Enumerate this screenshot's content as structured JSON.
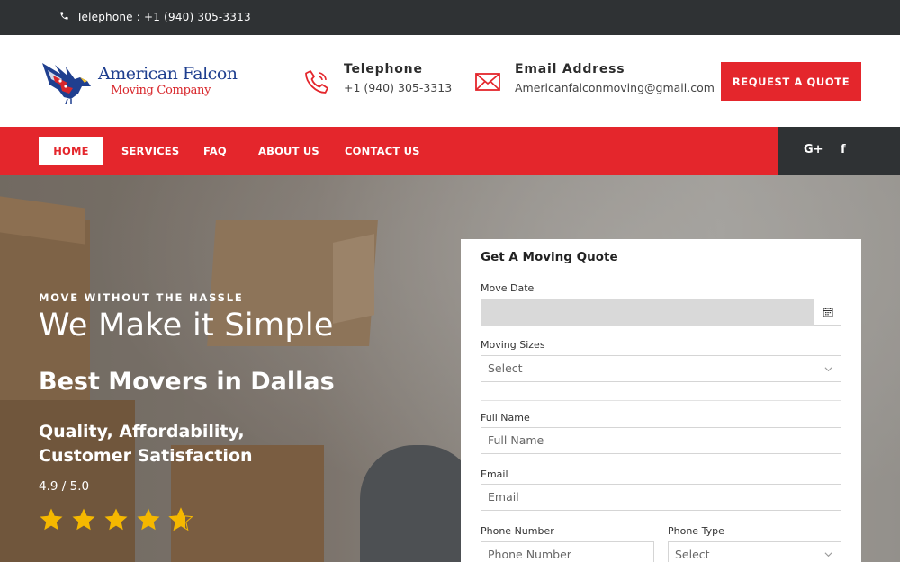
{
  "topbar": {
    "telephone": "Telephone : +1 (940) 305-3313"
  },
  "logo": {
    "line1": "American Falcon",
    "line2": "Moving Company"
  },
  "header": {
    "telephone_title": "Telephone",
    "telephone_value": "+1 (940) 305-3313",
    "email_title": "Email Address",
    "email_value": "Americanfalconmoving@gmail.com",
    "quote_button": "REQUEST A QUOTE"
  },
  "nav": {
    "items": [
      "HOME",
      "SERVICES",
      "FAQ",
      "ABOUT US",
      "CONTACT US"
    ],
    "social": [
      "G+",
      "f"
    ]
  },
  "hero": {
    "eyebrow": "MOVE WITHOUT THE HASSLE",
    "headline": "We Make it Simple",
    "subheadline": "Best Movers in Dallas",
    "tagline": "Quality, Affordability, Customer Satisfaction",
    "rating_text": "4.9 / 5.0",
    "rating_value": 4.9,
    "rating_max": 5
  },
  "form": {
    "title": "Get A Moving Quote",
    "move_date_label": "Move Date",
    "move_date_value": "",
    "moving_sizes_label": "Moving Sizes",
    "moving_sizes_value": "Select",
    "full_name_label": "Full Name",
    "full_name_placeholder": "Full Name",
    "email_label": "Email",
    "email_placeholder": "Email",
    "phone_number_label": "Phone Number",
    "phone_number_placeholder": "Phone Number",
    "phone_type_label": "Phone Type",
    "phone_type_value": "Select"
  },
  "colors": {
    "brand_red": "#e4262c",
    "dark": "#2f3234",
    "logo_blue": "#1f3f8f",
    "star": "#f5b800"
  },
  "icons": [
    "phone-icon",
    "phone-outline-icon",
    "envelope-icon",
    "calendar-icon",
    "chevron-down-icon",
    "star-icon",
    "google-plus-icon",
    "facebook-icon"
  ]
}
